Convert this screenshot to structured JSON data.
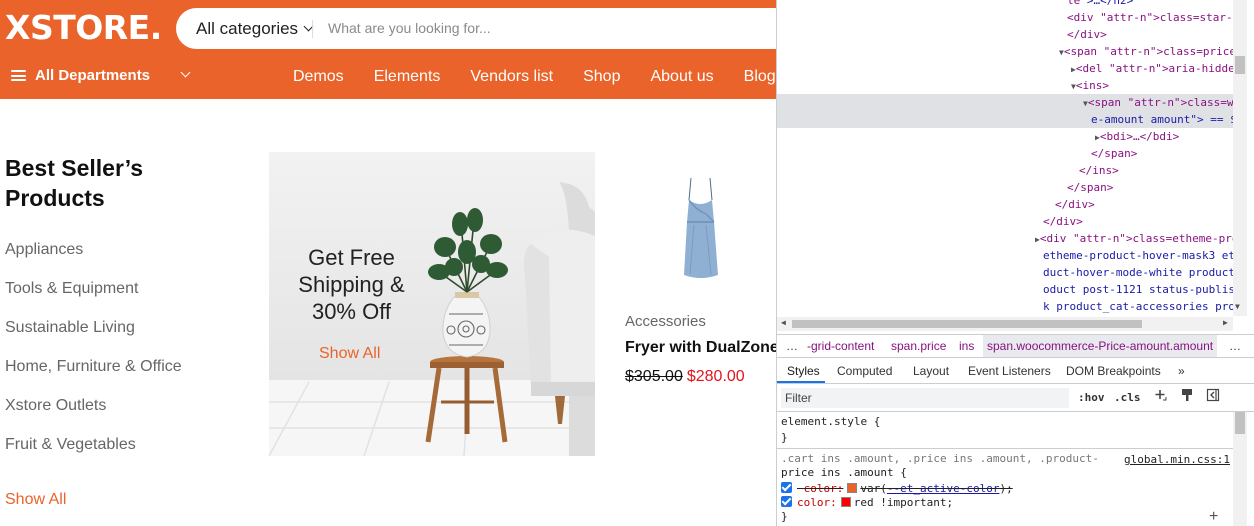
{
  "site": {
    "logo": "XSTORE.",
    "search": {
      "category": "All categories",
      "placeholder": "What are you looking for..."
    },
    "departments": "All Departments",
    "nav": [
      "Demos",
      "Elements",
      "Vendors list",
      "Shop",
      "About us",
      "Blog"
    ]
  },
  "sidebar": {
    "title": "Best Seller’s Products",
    "categories": [
      "Appliances",
      "Tools & Equipment",
      "Sustainable Living",
      "Home, Furniture & Office",
      "Xstore Outlets",
      "Fruit & Vegetables"
    ],
    "show_all": "Show All"
  },
  "banner": {
    "headline": "Get Free Shipping & 30% Off",
    "show_all": "Show All"
  },
  "product": {
    "category": "Accessories",
    "name": "Fryer with DualZone",
    "old_price": "$305.00",
    "new_price": "$280.00"
  },
  "colors": {
    "brand": "#e9632a",
    "sale_price": "#e5131d",
    "devtools_accent": "#1a73e8"
  },
  "devtools": {
    "dom_lines": [
      {
        "indent": 290,
        "tri": "",
        "text": "le\">…</h2>"
      },
      {
        "indent": 290,
        "tri": "",
        "text": "<div class=\"star-rating-w"
      },
      {
        "indent": 290,
        "tri": "",
        "text": "</div>"
      },
      {
        "indent": 282,
        "tri": "▼",
        "text": "<span class=\"price\">"
      },
      {
        "indent": 294,
        "tri": "▶",
        "text": "<del aria-hidden=\"true\""
      },
      {
        "indent": 294,
        "tri": "▼",
        "text": "<ins>"
      },
      {
        "indent": 306,
        "tri": "▼",
        "text": "<span class=\"woocomme"
      },
      {
        "indent": 314,
        "tri": "",
        "text": "e-amount amount\"> == $0"
      },
      {
        "indent": 318,
        "tri": "▶",
        "text": "<bdi>…</bdi>"
      },
      {
        "indent": 314,
        "tri": "",
        "text": "</span>"
      },
      {
        "indent": 302,
        "tri": "",
        "text": "</ins>"
      },
      {
        "indent": 290,
        "tri": "",
        "text": "</span>"
      },
      {
        "indent": 278,
        "tri": "",
        "text": "</div>"
      },
      {
        "indent": 266,
        "tri": "",
        "text": "</div>"
      },
      {
        "indent": 258,
        "tri": "▶",
        "text": "<div class=\"etheme-product-gr"
      },
      {
        "indent": 266,
        "tri": "",
        "text": "etheme-product-hover-mask3 et"
      },
      {
        "indent": 266,
        "tri": "",
        "text": "duct-hover-mode-white product"
      },
      {
        "indent": 266,
        "tri": "",
        "text": "oduct post-1121 status-publis"
      },
      {
        "indent": 266,
        "tri": "",
        "text": "k product_cat-accessories pro"
      }
    ],
    "selected_more": "…",
    "breadcrumbs": [
      "…",
      "-grid-content",
      "span.price",
      "ins",
      "span.woocommerce-Price-amount.amount",
      "…"
    ],
    "tabs": [
      "Styles",
      "Computed",
      "Layout",
      "Event Listeners",
      "DOM Breakpoints",
      "»"
    ],
    "filter_placeholder": "Filter",
    "hov": ":hov",
    "cls": ".cls",
    "styles": {
      "element_style_open": "element.style {",
      "element_style_close": "}",
      "rule_selector_1": ".cart ins .amount, .price ins .amount, .product-",
      "rule_selector_2": "price ins .amount {",
      "source": "global.min.css:1",
      "prop1_name": "color:",
      "prop1_value_pre": "var(",
      "prop1_var": "--et_active-color",
      "prop1_value_post": ");",
      "prop1_swatch": "#e9632a",
      "prop2_name": "color:",
      "prop2_value": "red !important;",
      "prop2_swatch": "#ff0000",
      "rule_close": "}",
      "add": "+"
    }
  }
}
